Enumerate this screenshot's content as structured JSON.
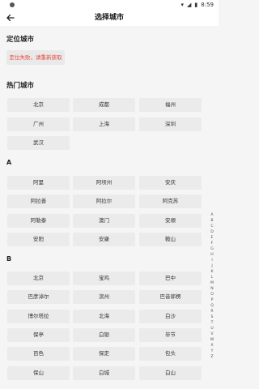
{
  "status": {
    "time": "8:59"
  },
  "header": {
    "title": "选择城市"
  },
  "located": {
    "title": "定位城市",
    "message": "定位失败，请重新获取"
  },
  "hot": {
    "title": "热门城市",
    "cities": [
      "北京",
      "成都",
      "福州",
      "广州",
      "上海",
      "深圳",
      "武汉"
    ]
  },
  "groups": [
    {
      "letter": "A",
      "cities": [
        "阿里",
        "阿坝州",
        "安庆",
        "阿拉善",
        "阿拉尔",
        "阿克苏",
        "阿勒泰",
        "澳门",
        "安顺",
        "安阳",
        "安康",
        "鞍山"
      ]
    },
    {
      "letter": "B",
      "cities": [
        "北京",
        "宝鸡",
        "巴中",
        "巴彦淖尔",
        "滨州",
        "巴音郭楞",
        "博尔塔拉",
        "北海",
        "白沙",
        "保亭",
        "白银",
        "毕节",
        "百色",
        "保定",
        "包头",
        "保山",
        "白城",
        "白山"
      ]
    }
  ],
  "index_letters": [
    "A",
    "B",
    "C",
    "D",
    "E",
    "F",
    "G",
    "H",
    "I",
    "J",
    "K",
    "L",
    "M",
    "N",
    "O",
    "P",
    "Q",
    "R",
    "S",
    "T",
    "U",
    "V",
    "W",
    "X",
    "Y",
    "Z"
  ]
}
